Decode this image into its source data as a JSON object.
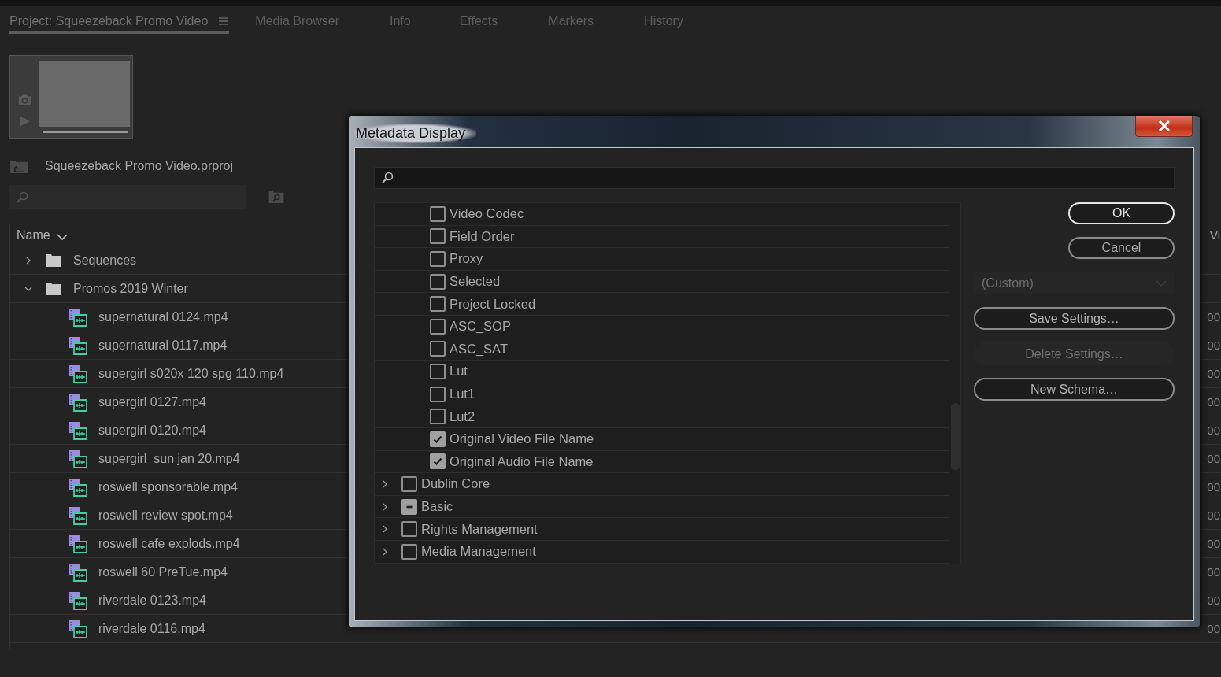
{
  "panel": {
    "tabs": [
      {
        "label": "Project: Squeezeback Promo Video",
        "selected": true,
        "menu": true
      },
      {
        "label": "Media Browser",
        "selected": false,
        "menu": false
      },
      {
        "label": "Info",
        "selected": false,
        "menu": false
      },
      {
        "label": "Effects",
        "selected": false,
        "menu": false
      },
      {
        "label": "Markers",
        "selected": false,
        "menu": false
      },
      {
        "label": "History",
        "selected": false,
        "menu": false
      }
    ],
    "project_file": "Squeezeback Promo Video.prproj",
    "table": {
      "columns": [
        "Name",
        "Vi"
      ],
      "rows": [
        {
          "name": "Sequences",
          "kind": "folder",
          "expanded": false
        },
        {
          "name": "Promos 2019 Winter",
          "kind": "folder",
          "expanded": true,
          "children": [
            {
              "name": "supernatural 0124.mp4",
              "kind": "clip",
              "column_2": "00"
            },
            {
              "name": "supernatural 0117.mp4",
              "kind": "clip",
              "column_2": "00"
            },
            {
              "name": "supergirl s020x 120 spg 110.mp4",
              "kind": "clip",
              "column_2": "00"
            },
            {
              "name": "supergirl 0127.mp4",
              "kind": "clip",
              "column_2": "00"
            },
            {
              "name": "supergirl 0120.mp4",
              "kind": "clip",
              "column_2": "00"
            },
            {
              "name": "supergirl  sun jan 20.mp4",
              "kind": "clip",
              "column_2": "00"
            },
            {
              "name": "roswell sponsorable.mp4",
              "kind": "clip",
              "column_2": "00"
            },
            {
              "name": "roswell review spot.mp4",
              "kind": "clip",
              "column_2": "00"
            },
            {
              "name": "roswell cafe explods.mp4",
              "kind": "clip",
              "column_2": "00"
            },
            {
              "name": "roswell 60 PreTue.mp4",
              "kind": "clip",
              "column_2": "00"
            },
            {
              "name": "riverdale 0123.mp4",
              "kind": "clip",
              "column_2": "00"
            },
            {
              "name": "riverdale 0116.mp4",
              "kind": "clip",
              "column_2": "00"
            }
          ]
        }
      ]
    }
  },
  "dialog": {
    "title": "Metadata Display",
    "tree": [
      {
        "children": [
          {
            "label": "Video Codec",
            "checked": false
          },
          {
            "label": "Field Order",
            "checked": false
          },
          {
            "label": "Proxy",
            "checked": false
          },
          {
            "label": "Selected",
            "checked": false
          },
          {
            "label": "Project Locked",
            "checked": false
          },
          {
            "label": "ASC_SOP",
            "checked": false
          },
          {
            "label": "ASC_SAT",
            "checked": false
          },
          {
            "label": "Lut",
            "checked": false
          },
          {
            "label": "Lut1",
            "checked": false
          },
          {
            "label": "Lut2",
            "checked": false
          },
          {
            "label": "Original Video File Name",
            "checked": true
          },
          {
            "label": "Original Audio File Name",
            "checked": true
          }
        ]
      },
      {
        "label": "Dublin Core",
        "expanded": false,
        "checked": false,
        "partial": false
      },
      {
        "label": "Basic",
        "expanded": false,
        "checked": false,
        "partial": true
      },
      {
        "label": "Rights Management",
        "expanded": false,
        "checked": false,
        "partial": false
      },
      {
        "label": "Media Management",
        "expanded": false,
        "checked": false,
        "partial": false
      }
    ],
    "buttons": [
      {
        "label": "OK",
        "kind": "default"
      },
      {
        "label": "Cancel",
        "kind": "normal"
      }
    ],
    "preset": {
      "value": "(Custom)",
      "disabled": true
    },
    "actions": [
      {
        "label": "Save Settings…",
        "disabled": false
      },
      {
        "label": "Delete Settings…",
        "disabled": true
      },
      {
        "label": "New Schema…",
        "disabled": false
      }
    ]
  }
}
